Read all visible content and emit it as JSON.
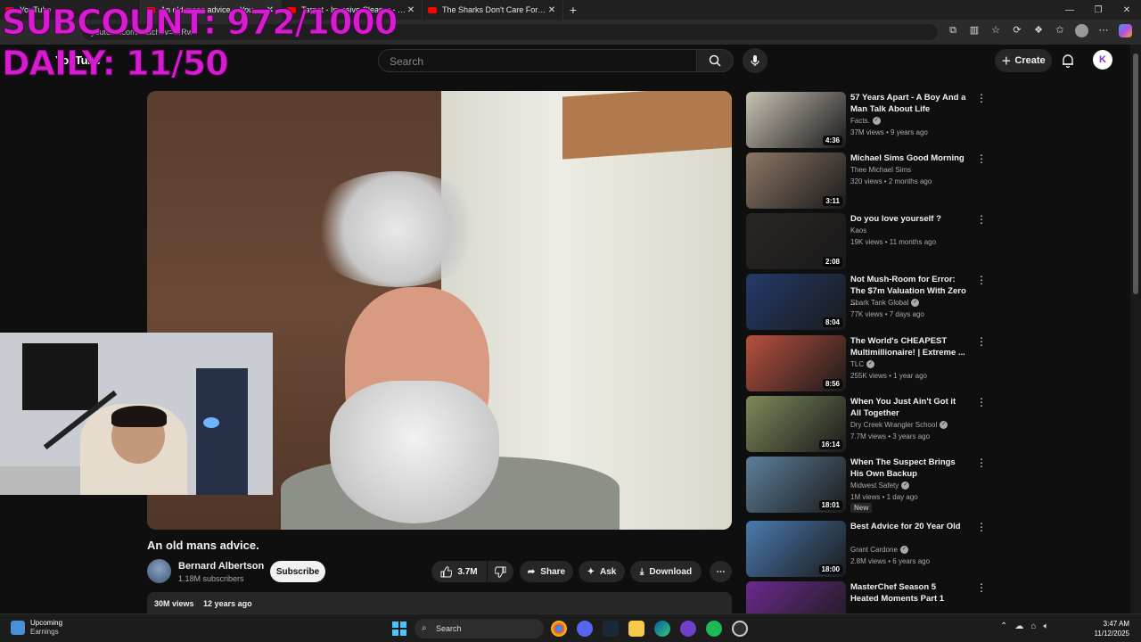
{
  "overlay": {
    "subcount": "SUBCOUNT: 972/1000",
    "daily": "DAILY: 11/50"
  },
  "browser": {
    "tabs": [
      {
        "label": "YouTube",
        "active": false
      },
      {
        "label": "An old mans advice. - YouTube",
        "active": true
      },
      {
        "label": "Target - Invasive Cleaner - YouTube",
        "active": false
      },
      {
        "label": "The Sharks Don't Care For Ticks!",
        "active": false
      }
    ],
    "new_tab": "+",
    "url": "youtube.com/watch?v=…Rw"
  },
  "youtube": {
    "logo": "YouTube",
    "search_placeholder": "Search",
    "create_label": "Create",
    "avatar_letter": "K"
  },
  "video": {
    "title": "An old mans advice.",
    "channel": "Bernard Albertson",
    "subscribers": "1.18M subscribers",
    "subscribe_label": "Subscribe",
    "likes": "3.7M",
    "share_label": "Share",
    "ask_label": "Ask",
    "download_label": "Download",
    "views": "30M views",
    "age": "12 years ago"
  },
  "recommendations": [
    {
      "title": "57 Years Apart - A Boy And a Man Talk About Life",
      "channel": "Facts.",
      "verified": true,
      "views": "37M views",
      "age": "9 years ago",
      "duration": "4:36",
      "thumb_color": "#c9c2b4",
      "new": false
    },
    {
      "title": "Michael Sims Good Morning",
      "channel": "Thee Michael Sims",
      "verified": false,
      "views": "320 views",
      "age": "2 months ago",
      "duration": "3:11",
      "thumb_color": "#8d7765",
      "new": false
    },
    {
      "title": "Do you love yourself ?",
      "channel": "Kaos",
      "verified": false,
      "views": "19K views",
      "age": "11 months ago",
      "duration": "2:08",
      "thumb_color": "#2a2522",
      "new": false
    },
    {
      "title": "Not Mush-Room for Error: The $7m Valuation With Zero ...",
      "channel": "Shark Tank Global",
      "verified": true,
      "views": "77K views",
      "age": "7 days ago",
      "duration": "8:04",
      "thumb_color": "#233a6a",
      "new": false
    },
    {
      "title": "The World's CHEAPEST Multimillionaire! | Extreme ...",
      "channel": "TLC",
      "verified": true,
      "views": "255K views",
      "age": "1 year ago",
      "duration": "8:56",
      "thumb_color": "#b8503e",
      "new": false
    },
    {
      "title": "When You Just Ain't Got it All Together",
      "channel": "Dry Creek Wrangler School",
      "verified": true,
      "views": "7.7M views",
      "age": "3 years ago",
      "duration": "16:14",
      "thumb_color": "#7d8a5a",
      "new": false
    },
    {
      "title": "When The Suspect Brings His Own Backup",
      "channel": "Midwest Safety",
      "verified": true,
      "views": "1M views",
      "age": "1 day ago",
      "duration": "18:01",
      "thumb_color": "#5d7f9a",
      "new": true
    },
    {
      "title": "Best Advice for 20 Year Old",
      "channel": "Grant Cardone",
      "verified": true,
      "views": "2.8M views",
      "age": "6 years ago",
      "duration": "18:00",
      "thumb_color": "#4a7ab0",
      "new": false
    },
    {
      "title": "MasterChef Season 5 Heated Moments Part 1",
      "channel": "",
      "verified": false,
      "views": "",
      "age": "",
      "duration": "",
      "thumb_color": "#6b2a8c",
      "new": false
    }
  ],
  "new_badge": "New",
  "taskbar": {
    "weather_title": "Upcoming",
    "weather_sub": "Earnings",
    "search_label": "Search",
    "time": "3:47 AM",
    "date": "11/12/2025"
  }
}
